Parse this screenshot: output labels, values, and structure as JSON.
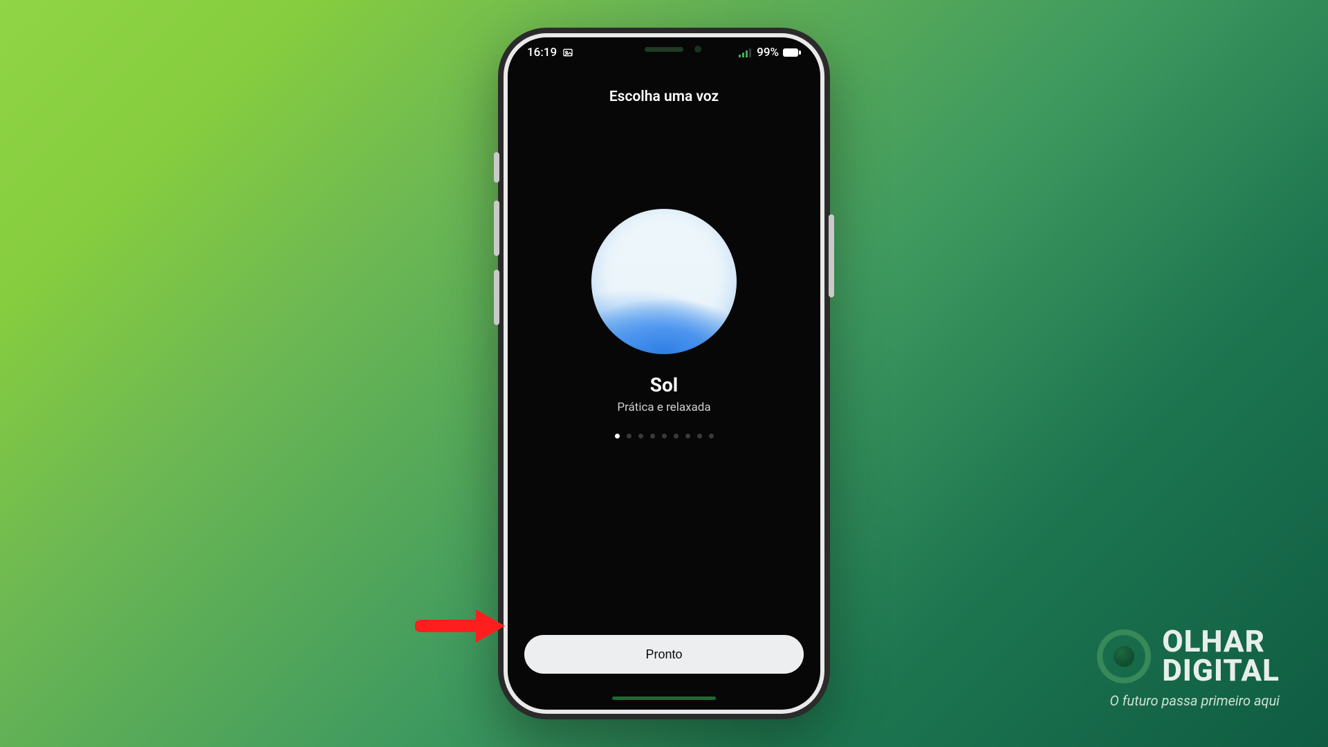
{
  "status": {
    "time": "16:19",
    "battery": "99%"
  },
  "app": {
    "title": "Escolha uma voz",
    "voice_name": "Sol",
    "voice_desc": "Prática e relaxada",
    "page_count": 9,
    "active_page_index": 0,
    "done_label": "Pronto"
  },
  "watermark": {
    "line1": "OLHAR",
    "line2": "DIGITAL",
    "slogan": "O futuro passa primeiro aqui"
  }
}
